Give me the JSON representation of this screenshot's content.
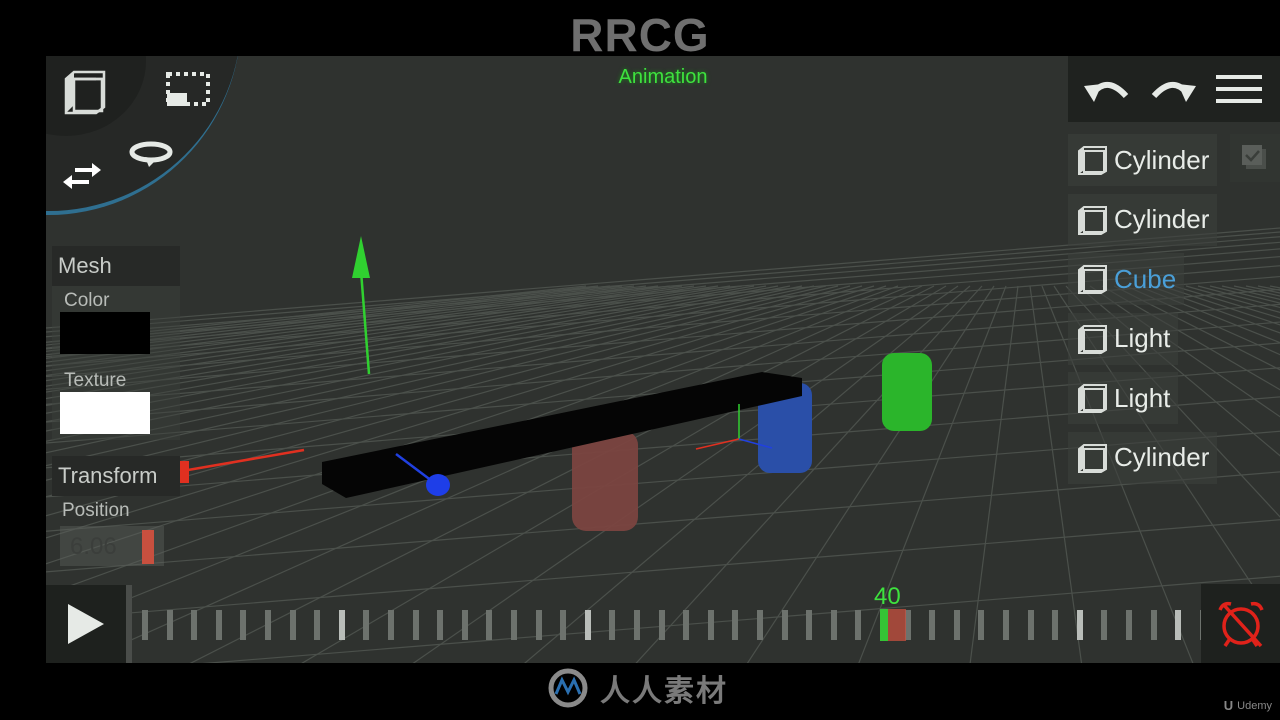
{
  "watermark": {
    "top_text": "RRCG",
    "footer_text": "人人素材",
    "udemy": "Udemy"
  },
  "mode": {
    "label": "Animation",
    "color": "#3ee23e"
  },
  "tools": [
    {
      "name": "object-mode",
      "icon": "cube-icon"
    },
    {
      "name": "select-region",
      "icon": "dotted-selection-icon"
    },
    {
      "name": "rotate",
      "icon": "rotate-icon"
    },
    {
      "name": "move",
      "icon": "swap-arrows-icon"
    }
  ],
  "toolbar": {
    "undo": "undo-icon",
    "redo": "redo-icon",
    "menu": "hamburger-menu-icon"
  },
  "outliner": {
    "items": [
      {
        "label": "Cylinder",
        "selected": false
      },
      {
        "label": "Cylinder",
        "selected": false
      },
      {
        "label": "Cube",
        "selected": true
      },
      {
        "label": "Light",
        "selected": false
      },
      {
        "label": "Light",
        "selected": false
      },
      {
        "label": "Cylinder",
        "selected": false
      }
    ],
    "visibility_checked": true,
    "selected_color": "#4a9fd8"
  },
  "inspector": {
    "mesh_header": "Mesh",
    "color_label": "Color",
    "color_value": "#000000",
    "texture_label": "Texture",
    "texture_value": "#ffffff",
    "transform_header": "Transform",
    "position_label": "Position",
    "position_value": "6.06"
  },
  "timeline": {
    "current_frame": "40",
    "current_frame_number": 40,
    "tick_count": 48,
    "major_tick_indices": [
      8,
      18,
      38,
      42
    ],
    "playhead_index": 30,
    "keyframe_index": 30,
    "play_icon": "play-icon",
    "record_icon": "alarm-off-icon",
    "record_color": "#e0221a"
  },
  "scene": {
    "objects": [
      {
        "name": "Cube",
        "color": "#000000"
      },
      {
        "name": "Cylinder",
        "color": "#8a4a44"
      },
      {
        "name": "Cylinder",
        "color": "#2850b0"
      },
      {
        "name": "Cylinder",
        "color": "#2ec02e"
      }
    ],
    "gizmo_colors": {
      "x": "#e03020",
      "y": "#30d030",
      "z": "#2040e0"
    }
  }
}
